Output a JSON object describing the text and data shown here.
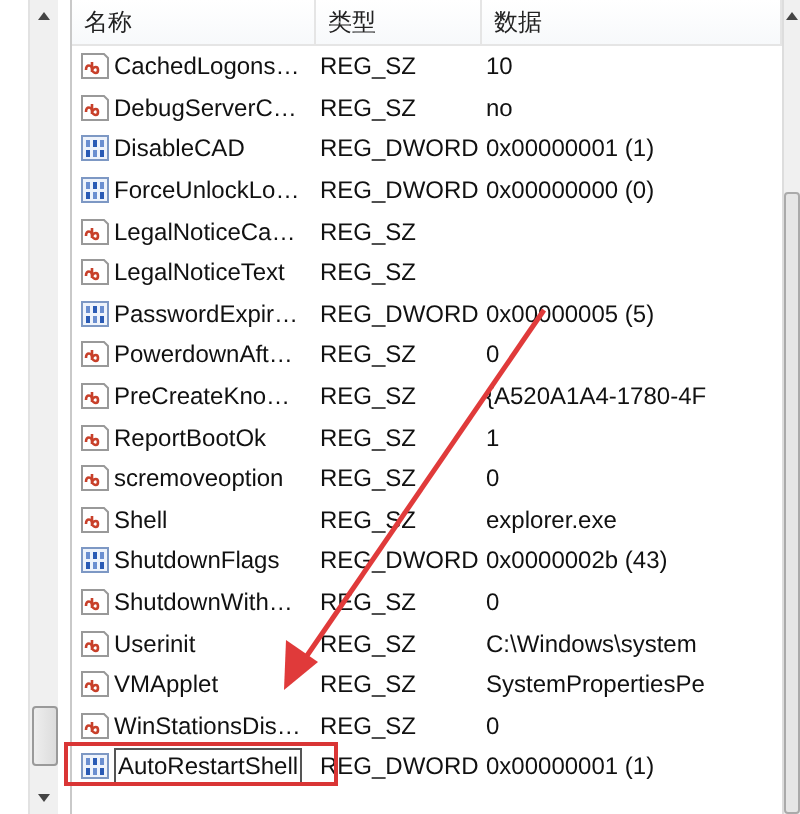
{
  "columns": [
    "名称",
    "类型",
    "数据"
  ],
  "rows": [
    {
      "kind": "sz",
      "name": "CachedLogons…",
      "type": "REG_SZ",
      "data": "10",
      "editing": false
    },
    {
      "kind": "sz",
      "name": "DebugServerC…",
      "type": "REG_SZ",
      "data": "no",
      "editing": false
    },
    {
      "kind": "dword",
      "name": "DisableCAD",
      "type": "REG_DWORD",
      "data": "0x00000001 (1)",
      "editing": false
    },
    {
      "kind": "dword",
      "name": "ForceUnlockLo…",
      "type": "REG_DWORD",
      "data": "0x00000000 (0)",
      "editing": false
    },
    {
      "kind": "sz",
      "name": "LegalNoticeCa…",
      "type": "REG_SZ",
      "data": "",
      "editing": false
    },
    {
      "kind": "sz",
      "name": "LegalNoticeText",
      "type": "REG_SZ",
      "data": "",
      "editing": false
    },
    {
      "kind": "dword",
      "name": "PasswordExpir…",
      "type": "REG_DWORD",
      "data": "0x00000005 (5)",
      "editing": false
    },
    {
      "kind": "sz",
      "name": "PowerdownAft…",
      "type": "REG_SZ",
      "data": "0",
      "editing": false
    },
    {
      "kind": "sz",
      "name": "PreCreateKno…",
      "type": "REG_SZ",
      "data": "{A520A1A4-1780-4F",
      "editing": false
    },
    {
      "kind": "sz",
      "name": "ReportBootOk",
      "type": "REG_SZ",
      "data": "1",
      "editing": false
    },
    {
      "kind": "sz",
      "name": "scremoveoption",
      "type": "REG_SZ",
      "data": "0",
      "editing": false
    },
    {
      "kind": "sz",
      "name": "Shell",
      "type": "REG_SZ",
      "data": "explorer.exe",
      "editing": false
    },
    {
      "kind": "dword",
      "name": "ShutdownFlags",
      "type": "REG_DWORD",
      "data": "0x0000002b (43)",
      "editing": false
    },
    {
      "kind": "sz",
      "name": "ShutdownWith…",
      "type": "REG_SZ",
      "data": "0",
      "editing": false
    },
    {
      "kind": "sz",
      "name": "Userinit",
      "type": "REG_SZ",
      "data": "C:\\Windows\\system",
      "editing": false
    },
    {
      "kind": "sz",
      "name": "VMApplet",
      "type": "REG_SZ",
      "data": "SystemPropertiesPe",
      "editing": false
    },
    {
      "kind": "sz",
      "name": "WinStationsDis…",
      "type": "REG_SZ",
      "data": "0",
      "editing": false
    },
    {
      "kind": "dword",
      "name": "AutoRestartShell",
      "type": "REG_DWORD",
      "data": "0x00000001 (1)",
      "editing": true
    }
  ]
}
